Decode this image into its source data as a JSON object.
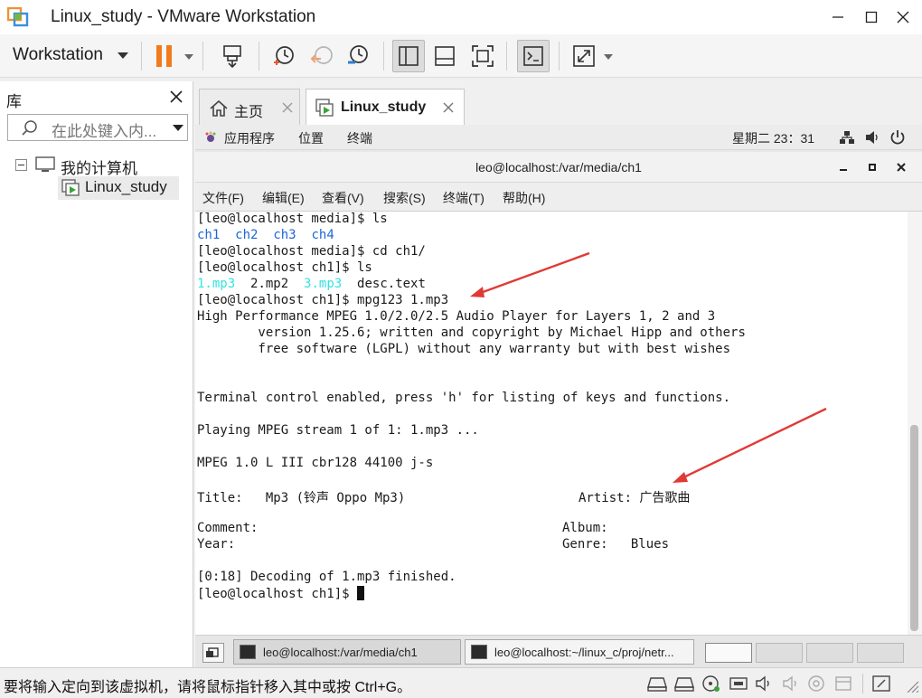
{
  "window": {
    "title": "Linux_study - VMware Workstation"
  },
  "toolbar": {
    "workstation_menu": "Workstation"
  },
  "library": {
    "title": "库",
    "search_placeholder": "在此处键入内...",
    "tree": {
      "root_label": "我的计算机",
      "vm_label": "Linux_study"
    }
  },
  "tabs": {
    "home_label": "主页",
    "vm_label": "Linux_study"
  },
  "guest_panel": {
    "applications": "应用程序",
    "places": "位置",
    "terminal": "终端",
    "clock": "星期二 23：31"
  },
  "terminal": {
    "title": "leo@localhost:/var/media/ch1",
    "menu": {
      "file": "文件(F)",
      "edit": "编辑(E)",
      "view": "查看(V)",
      "search": "搜索(S)",
      "terminal": "终端(T)",
      "help": "帮助(H)"
    },
    "lines": {
      "l1": "[leo@localhost media]$ ls",
      "l2_ch1": "ch1",
      "l2_ch2": "ch2",
      "l2_ch3": "ch3",
      "l2_ch4": "ch4",
      "l3": "[leo@localhost media]$ cd ch1/",
      "l4": "[leo@localhost ch1]$ ls",
      "l5_f1": "1.mp3",
      "l5_f2": "2.mp2",
      "l5_f3": "3.mp3",
      "l5_f4": "desc.text",
      "l6": "[leo@localhost ch1]$ mpg123 1.mp3",
      "l7": "High Performance MPEG 1.0/2.0/2.5 Audio Player for Layers 1, 2 and 3",
      "l8": "        version 1.25.6; written and copyright by Michael Hipp and others",
      "l9": "        free software (LGPL) without any warranty but with best wishes",
      "l10": "Terminal control enabled, press 'h' for listing of keys and functions.",
      "l11": "Playing MPEG stream 1 of 1: 1.mp3 ...",
      "l12": "MPEG 1.0 L III cbr128 44100 j-s",
      "l13_title": "Title:   Mp3 (铃声 Oppo Mp3)",
      "l13_artist": "Artist: 广告歌曲",
      "l14_comment": "Comment:",
      "l14_album": "Album:",
      "l15_year": "Year:",
      "l15_genre": "Genre:   Blues",
      "l16": "[0:18] Decoding of 1.mp3 finished.",
      "l17": "[leo@localhost ch1]$ "
    }
  },
  "guest_taskbar": {
    "item1": "leo@localhost:/var/media/ch1",
    "item2": "leo@localhost:~/linux_c/proj/netr..."
  },
  "status": {
    "message": "要将输入定向到该虚拟机，请将鼠标指针移入其中或按 Ctrl+G。"
  },
  "colors": {
    "pause_orange": "#f07b1e",
    "arrow_red": "#e03a36",
    "ls_blue": "#1c67d8",
    "ls_teal": "#34e2e2"
  }
}
